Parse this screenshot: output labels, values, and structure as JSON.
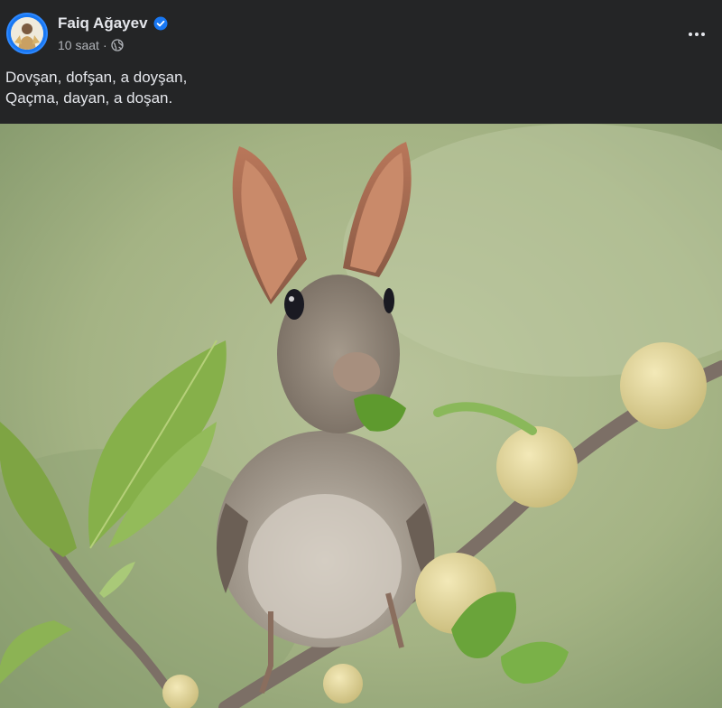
{
  "post": {
    "author": {
      "name": "Faiq Ağayev",
      "verified": true,
      "verified_icon": "verified-badge-icon",
      "avatar_icon": "profile-avatar"
    },
    "meta": {
      "time": "10 saat",
      "separator": "·",
      "audience_icon": "globe-icon"
    },
    "more_icon": "more-options-icon",
    "text_lines": [
      "Dovşan, dofşan, a doyşan,",
      "Qaçma, dayan, a doşan."
    ],
    "photo": {
      "subject": "rabbit-headed bird on a branch"
    }
  },
  "theme": {
    "background": "#242526",
    "text_primary": "#e4e6eb",
    "text_secondary": "#b0b3b8",
    "verified_blue": "#1877f2"
  }
}
